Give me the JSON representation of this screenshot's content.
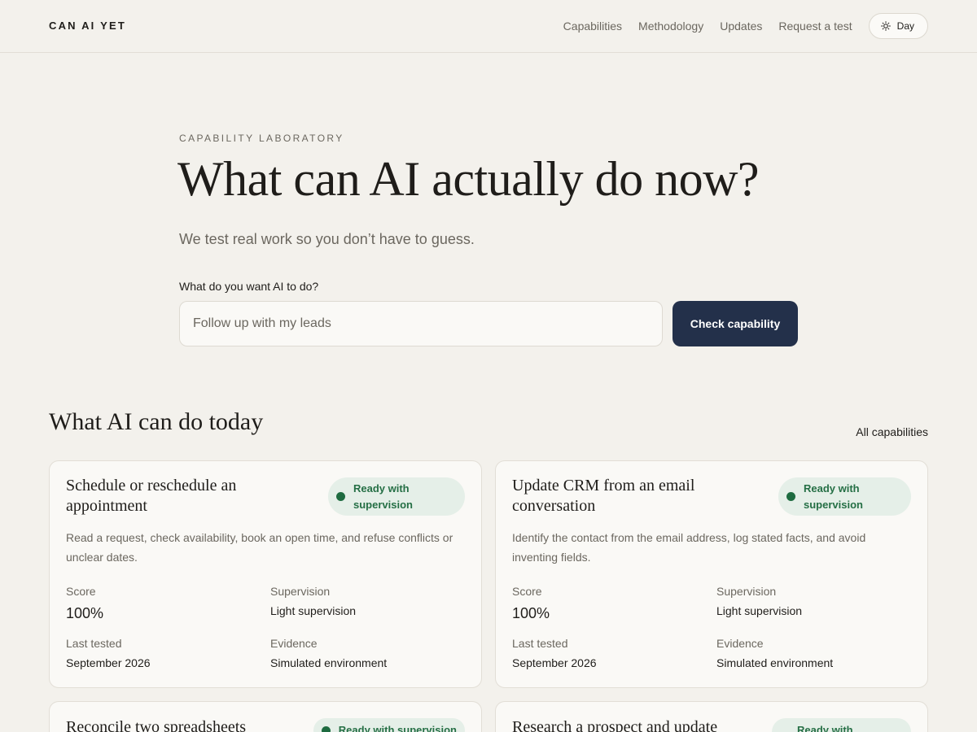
{
  "header": {
    "brand": "CAN AI YET",
    "nav": [
      "Capabilities",
      "Methodology",
      "Updates",
      "Request a test"
    ],
    "theme_label": "Day",
    "theme_icon": "sun-icon"
  },
  "hero": {
    "eyebrow": "CAPABILITY LABORATORY",
    "title": "What can AI actually do now?",
    "subtitle": "We test real work so you don’t have to guess.",
    "field_label": "What do you want AI to do?",
    "input_placeholder": "Follow up with my leads",
    "button_label": "Check capability"
  },
  "section": {
    "title": "What AI can do today",
    "link": "All capabilities"
  },
  "meta_labels": {
    "score": "Score",
    "supervision": "Supervision",
    "last_tested": "Last tested",
    "evidence": "Evidence"
  },
  "colors": {
    "background": "#f3f1ec",
    "primary_button": "#23304a",
    "badge_bg": "#e5efe8",
    "badge_text": "#256f45"
  },
  "cards": [
    {
      "title": "Schedule or reschedule an appointment",
      "status": "Ready with supervision",
      "description": "Read a request, check availability, book an open time, and refuse conflicts or unclear dates.",
      "score": "100%",
      "supervision": "Light supervision",
      "last_tested": "September 2026",
      "evidence": "Simulated environment"
    },
    {
      "title": "Update CRM from an email conversation",
      "status": "Ready with supervision",
      "description": "Identify the contact from the email address, log stated facts, and avoid inventing fields.",
      "score": "100%",
      "supervision": "Light supervision",
      "last_tested": "September 2026",
      "evidence": "Simulated environment"
    },
    {
      "title": "Reconcile two spreadsheets",
      "status": "Ready with supervision"
    },
    {
      "title": "Research a prospect and update",
      "status": "Ready with"
    }
  ]
}
